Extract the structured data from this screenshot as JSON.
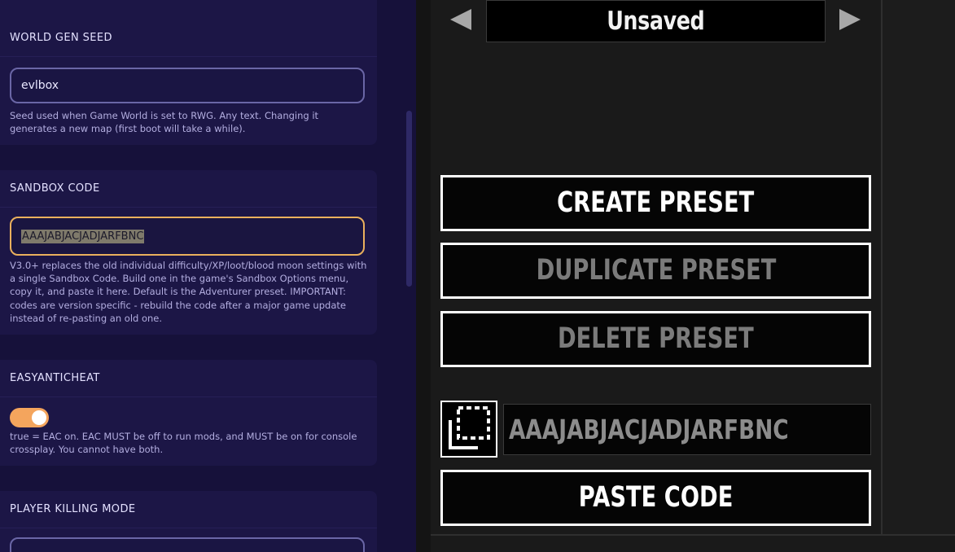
{
  "settings": {
    "world_gen_seed": {
      "title": "WORLD GEN SEED",
      "value": "evlbox",
      "help": "Seed used when Game World is set to RWG. Any text. Changing it generates a new map (first boot will take a while)."
    },
    "sandbox_code": {
      "title": "SANDBOX CODE",
      "value": "AAAJABJACJADJARFBNC",
      "help": "V3.0+ replaces the old individual difficulty/XP/loot/blood moon settings with a single Sandbox Code. Build one in the game's Sandbox Options menu, copy it, and paste it here. Default is the Adventurer preset. IMPORTANT: codes are version specific - rebuild the code after a major game update instead of re-pasting an old one."
    },
    "easyanticheat": {
      "title": "EASYANTICHEAT",
      "enabled": true,
      "help": "true = EAC on. EAC MUST be off to run mods, and MUST be on for console crossplay. You cannot have both."
    },
    "player_killing_mode": {
      "title": "PLAYER KILLING MODE",
      "value": ""
    }
  },
  "preset_panel": {
    "preset_name": "Unsaved",
    "create_label": "CREATE PRESET",
    "duplicate_label": "DUPLICATE PRESET",
    "delete_label": "DELETE PRESET",
    "code_value": "AAAJABJACJADJARFBNC",
    "paste_label": "PASTE CODE"
  },
  "colors": {
    "panel_bg": "#16113a",
    "card_bg": "#1c1646",
    "focus_accent": "#eab05d",
    "toggle_on": "#f4a55d",
    "disabled_text": "#7b7b7b"
  }
}
